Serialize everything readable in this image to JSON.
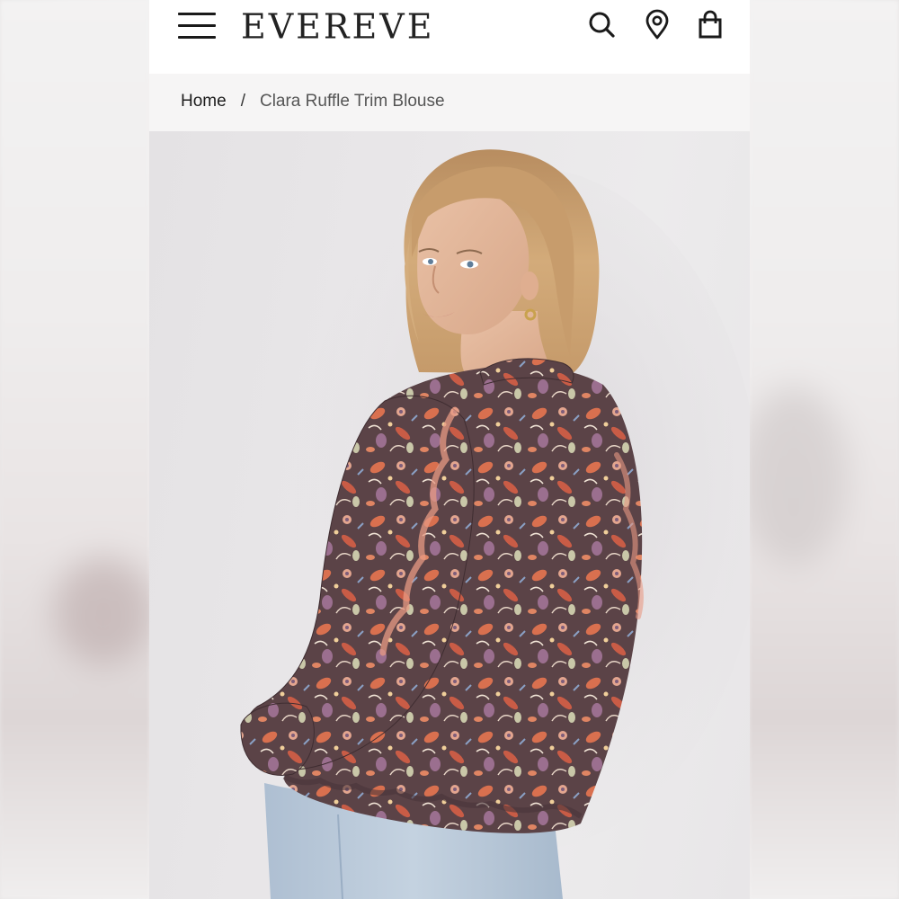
{
  "header": {
    "logo_text": "EVEREVE",
    "menu_icon": "hamburger-menu-icon",
    "search_icon": "search-icon",
    "location_icon": "location-pin-icon",
    "bag_icon": "shopping-bag-icon"
  },
  "breadcrumb": {
    "home": "Home",
    "separator": "/",
    "current": "Clara Ruffle Trim Blouse"
  },
  "colors": {
    "text_dark": "#1a1a1a",
    "breadcrumb_bg": "#f6f5f5",
    "photo_bg": "#e9e7e9",
    "blouse_base": "#5a4246",
    "blouse_accent": "#d9704f",
    "jeans": "#b9c8d8",
    "hair": "#c9a071"
  }
}
